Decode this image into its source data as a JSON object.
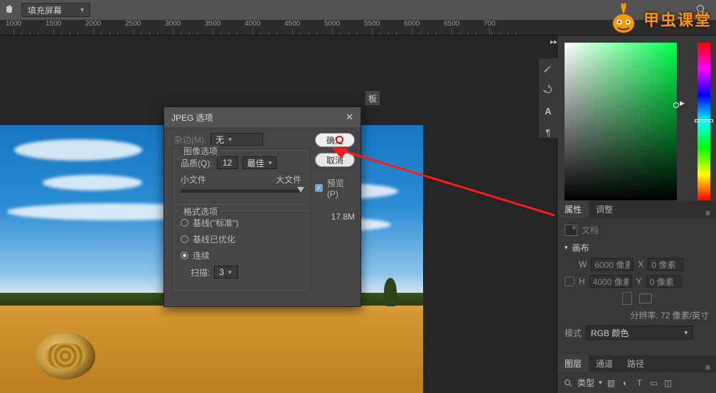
{
  "topbar": {
    "fit_mode": "填充屏幕"
  },
  "ruler_ticks": [
    "1000",
    "1500",
    "2000",
    "2500",
    "3000",
    "3500",
    "4000",
    "4500",
    "5000",
    "5500",
    "6000",
    "6500",
    "700"
  ],
  "dialog": {
    "title": "JPEG 选项",
    "matte_label": "杂边(M):",
    "matte_value": "无",
    "ok": "确定",
    "cancel": "取消",
    "image_options": "图像选项",
    "quality_label": "品质(Q):",
    "quality_value": "12",
    "quality_preset": "最佳",
    "small_file": "小文件",
    "large_file": "大文件",
    "preview_label": "预览(P)",
    "filesize": "17.8M",
    "format_options": "格式选项",
    "radio_baseline_std": "基线(\"标准\")",
    "radio_baseline_opt": "基线已优化",
    "radio_progressive": "连续",
    "scans_label": "扫描:",
    "scans_value": "3"
  },
  "tab_stub": "板",
  "panel": {
    "tabs_props": [
      "属性",
      "调整"
    ],
    "doc_label": "文档",
    "canvas_label": "画布",
    "w_label": "W",
    "h_label": "H",
    "x_label": "X",
    "y_label": "Y",
    "w_value": "6000 像素",
    "h_value": "4000 像素",
    "x_value": "0 像素",
    "y_value": "0 像素",
    "resolution": "分辨率: 72 像素/英寸",
    "mode_label": "模式",
    "mode_value": "RGB 颜色",
    "tabs_layers": [
      "图层",
      "通道",
      "路径"
    ],
    "type_label": "类型"
  },
  "logo_text": "甲虫课堂",
  "icons": {
    "brush": "brush",
    "history": "history",
    "type": "A",
    "para": "¶"
  }
}
